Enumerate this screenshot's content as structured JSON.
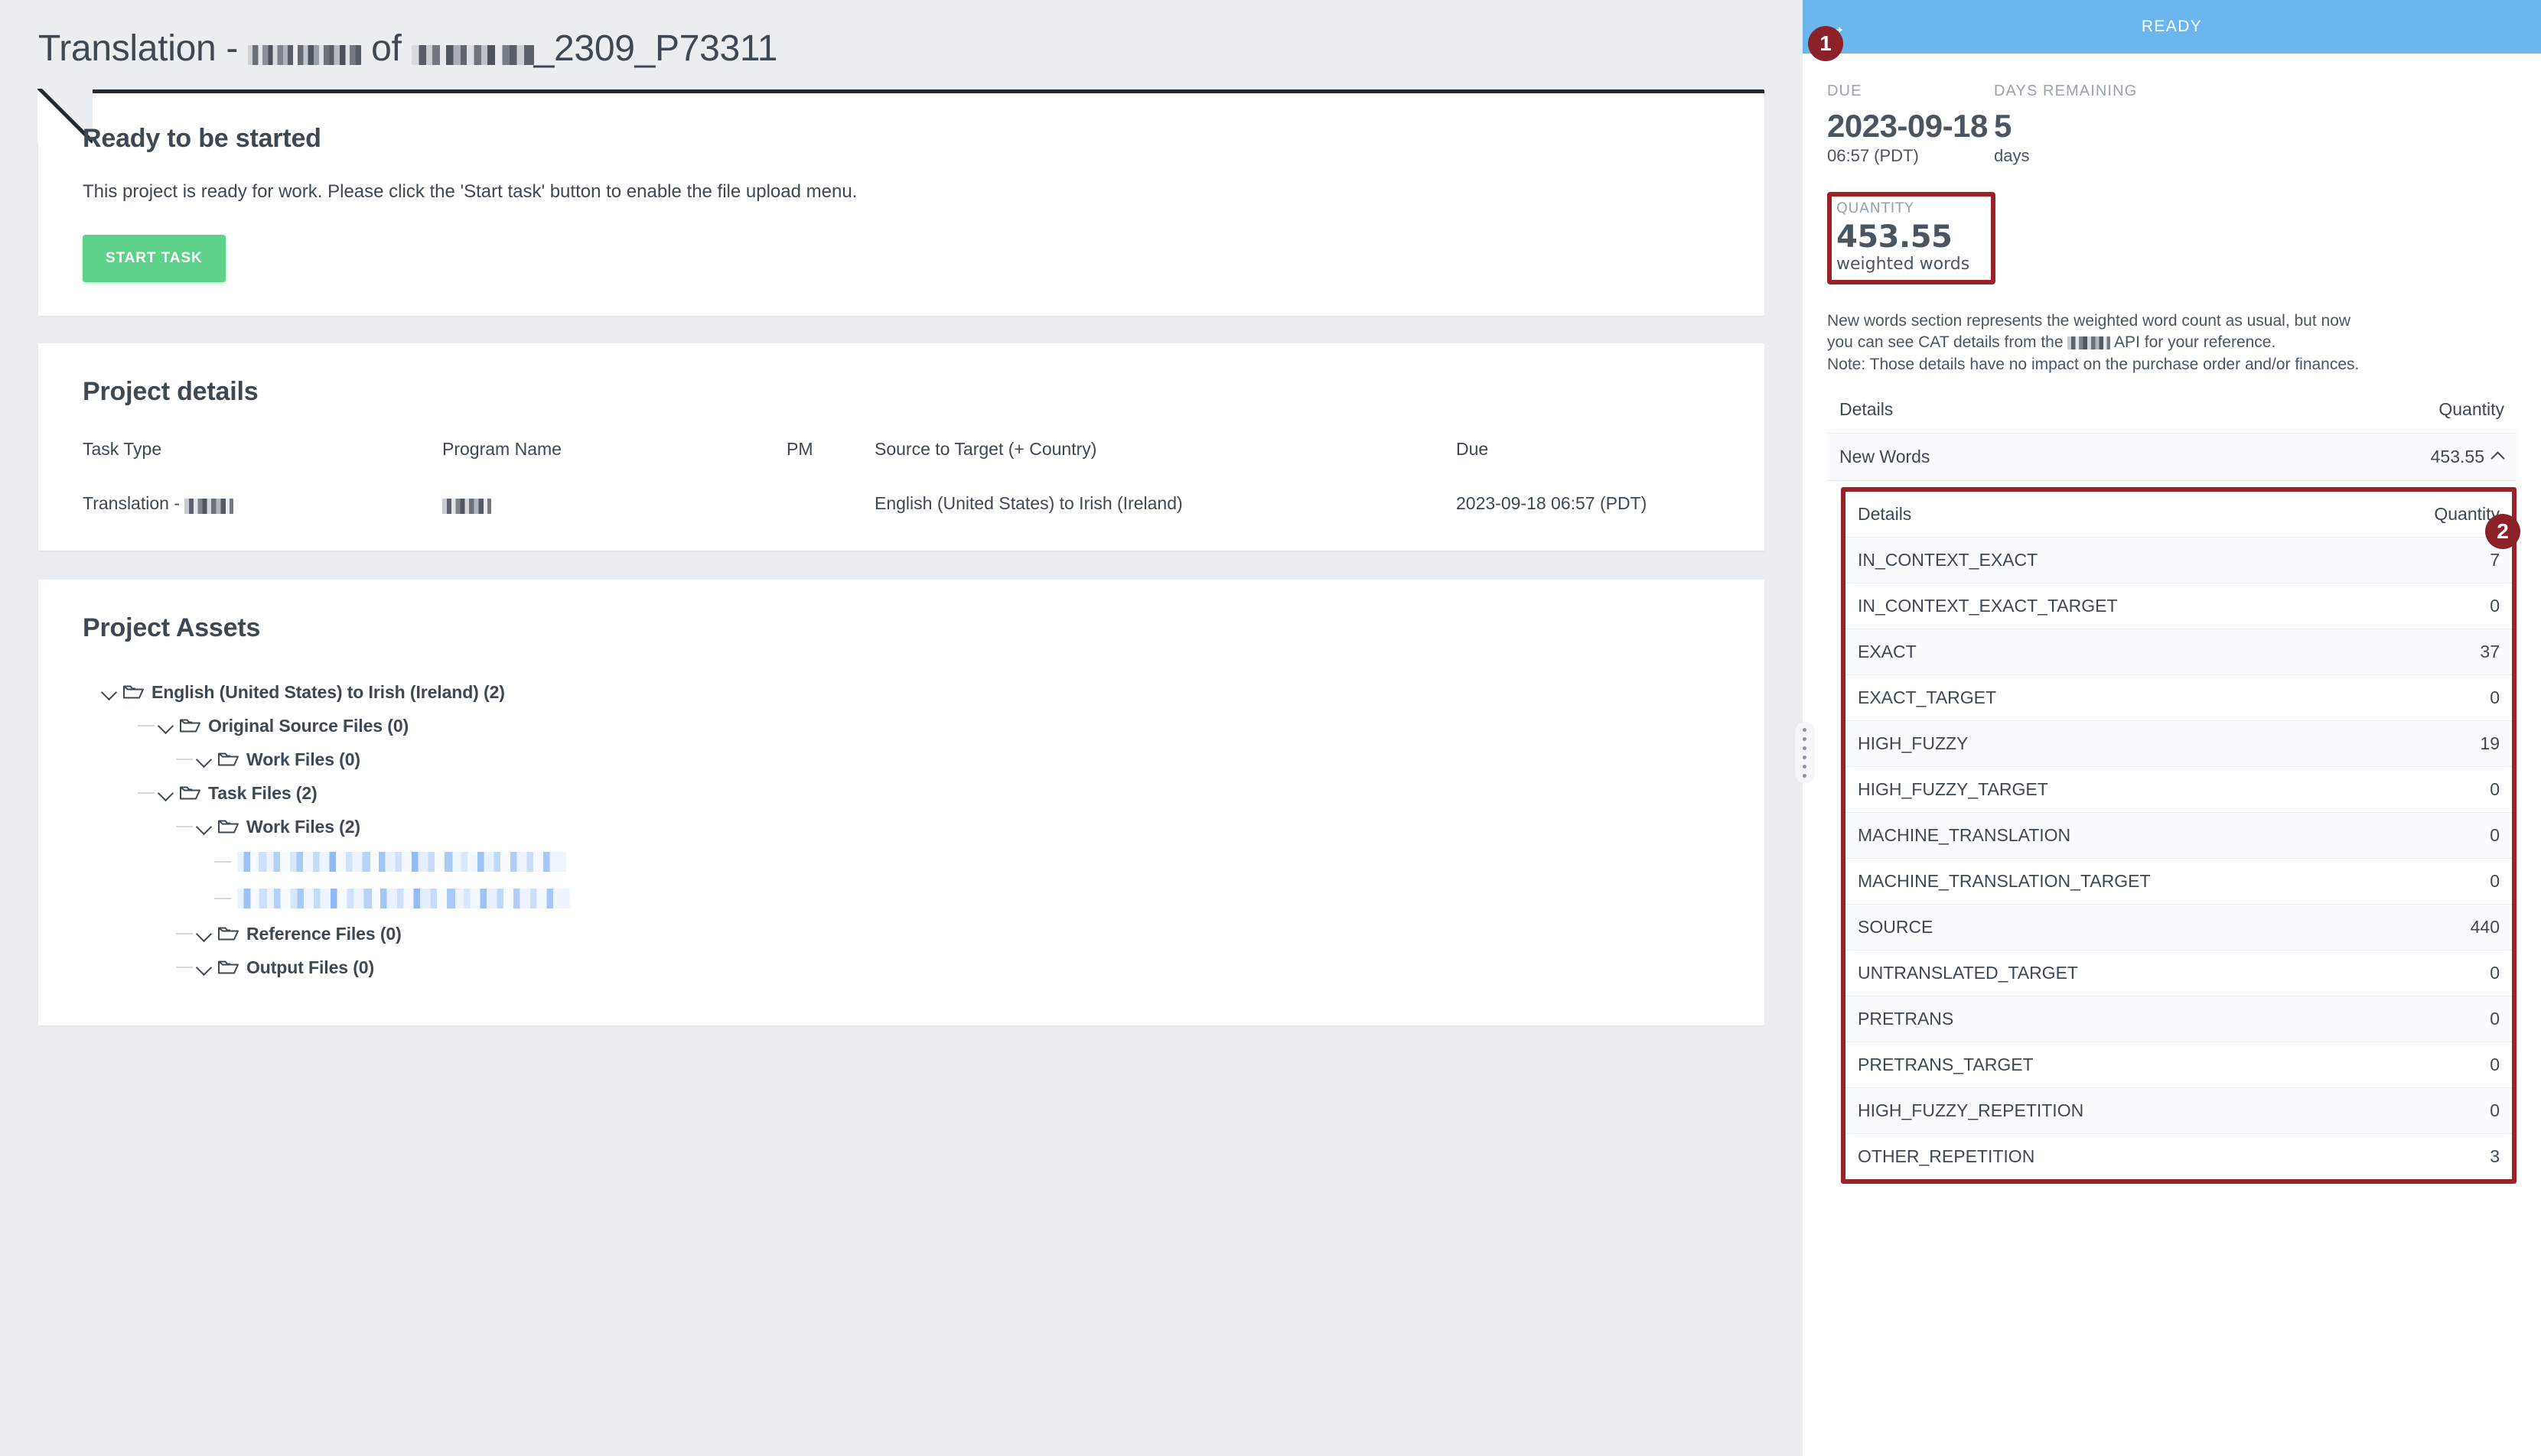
{
  "page": {
    "title_prefix": "Translation - ",
    "title_of": " of ",
    "title_suffix": "_2309_P73311"
  },
  "ready_card": {
    "heading": "Ready to be started",
    "description": "This project is ready for work. Please click the 'Start task' button to enable the file upload menu.",
    "start_button": "START TASK"
  },
  "project_details": {
    "section_title": "Project details",
    "headers": [
      "Task Type",
      "Program Name",
      "PM",
      "Source to Target (+ Country)",
      "Due"
    ],
    "row": {
      "task_type_prefix": "Translation - ",
      "program_name": "",
      "pm": "",
      "source_to_target": "English (United States) to Irish (Ireland)",
      "due": "2023-09-18 06:57 (PDT)"
    }
  },
  "project_assets": {
    "section_title": "Project Assets",
    "nodes": [
      {
        "label": "English (United States) to Irish (Ireland) (2)",
        "depth": 0,
        "type": "folder"
      },
      {
        "label": "Original Source Files (0)",
        "depth": 1,
        "type": "folder"
      },
      {
        "label": "Work Files (0)",
        "depth": 2,
        "type": "folder"
      },
      {
        "label": "Task Files (2)",
        "depth": 1,
        "type": "folder"
      },
      {
        "label": "Work Files (2)",
        "depth": 2,
        "type": "folder"
      },
      {
        "label": "",
        "depth": 3,
        "type": "file-redacted"
      },
      {
        "label": "",
        "depth": 3,
        "type": "file-redacted"
      },
      {
        "label": "Reference Files (0)",
        "depth": 2,
        "type": "folder"
      },
      {
        "label": "Output Files (0)",
        "depth": 2,
        "type": "folder"
      }
    ]
  },
  "sidebar": {
    "status": "READY",
    "status_color": "#6bb6ec",
    "forward_icon": "arrow-right",
    "due_label": "DUE",
    "due_date": "2023-09-18",
    "due_time": "06:57 (PDT)",
    "days_label": "DAYS REMAINING",
    "days_value": "5",
    "days_unit": "days",
    "quantity_label": "QUANTITY",
    "quantity_value": "453.55",
    "quantity_unit": "weighted words",
    "note_line_1": "New words section represents the weighted word count as usual, but now",
    "note_line_2_a": "you can see CAT details from the ",
    "note_line_2_b": " API for your reference.",
    "note_line_3": "Note: Those details have no impact on the purchase order and/or finances.",
    "outer_table": {
      "headers": [
        "Details",
        "Quantity"
      ],
      "rows": [
        {
          "label": "New Words",
          "value": "453.55",
          "expanded": true
        }
      ]
    },
    "inner_table": {
      "headers": [
        "Details",
        "Quantity"
      ],
      "rows": [
        {
          "label": "IN_CONTEXT_EXACT",
          "value": "7"
        },
        {
          "label": "IN_CONTEXT_EXACT_TARGET",
          "value": "0"
        },
        {
          "label": "EXACT",
          "value": "37"
        },
        {
          "label": "EXACT_TARGET",
          "value": "0"
        },
        {
          "label": "HIGH_FUZZY",
          "value": "19"
        },
        {
          "label": "HIGH_FUZZY_TARGET",
          "value": "0"
        },
        {
          "label": "MACHINE_TRANSLATION",
          "value": "0"
        },
        {
          "label": "MACHINE_TRANSLATION_TARGET",
          "value": "0"
        },
        {
          "label": "SOURCE",
          "value": "440"
        },
        {
          "label": "UNTRANSLATED_TARGET",
          "value": "0"
        },
        {
          "label": "PRETRANS",
          "value": "0"
        },
        {
          "label": "PRETRANS_TARGET",
          "value": "0"
        },
        {
          "label": "HIGH_FUZZY_REPETITION",
          "value": "0"
        },
        {
          "label": "OTHER_REPETITION",
          "value": "3"
        }
      ]
    }
  },
  "annotations": {
    "badge_1": "1",
    "badge_2": "2",
    "badge_color": "#8b2129",
    "highlight_color": "#9c2228"
  }
}
